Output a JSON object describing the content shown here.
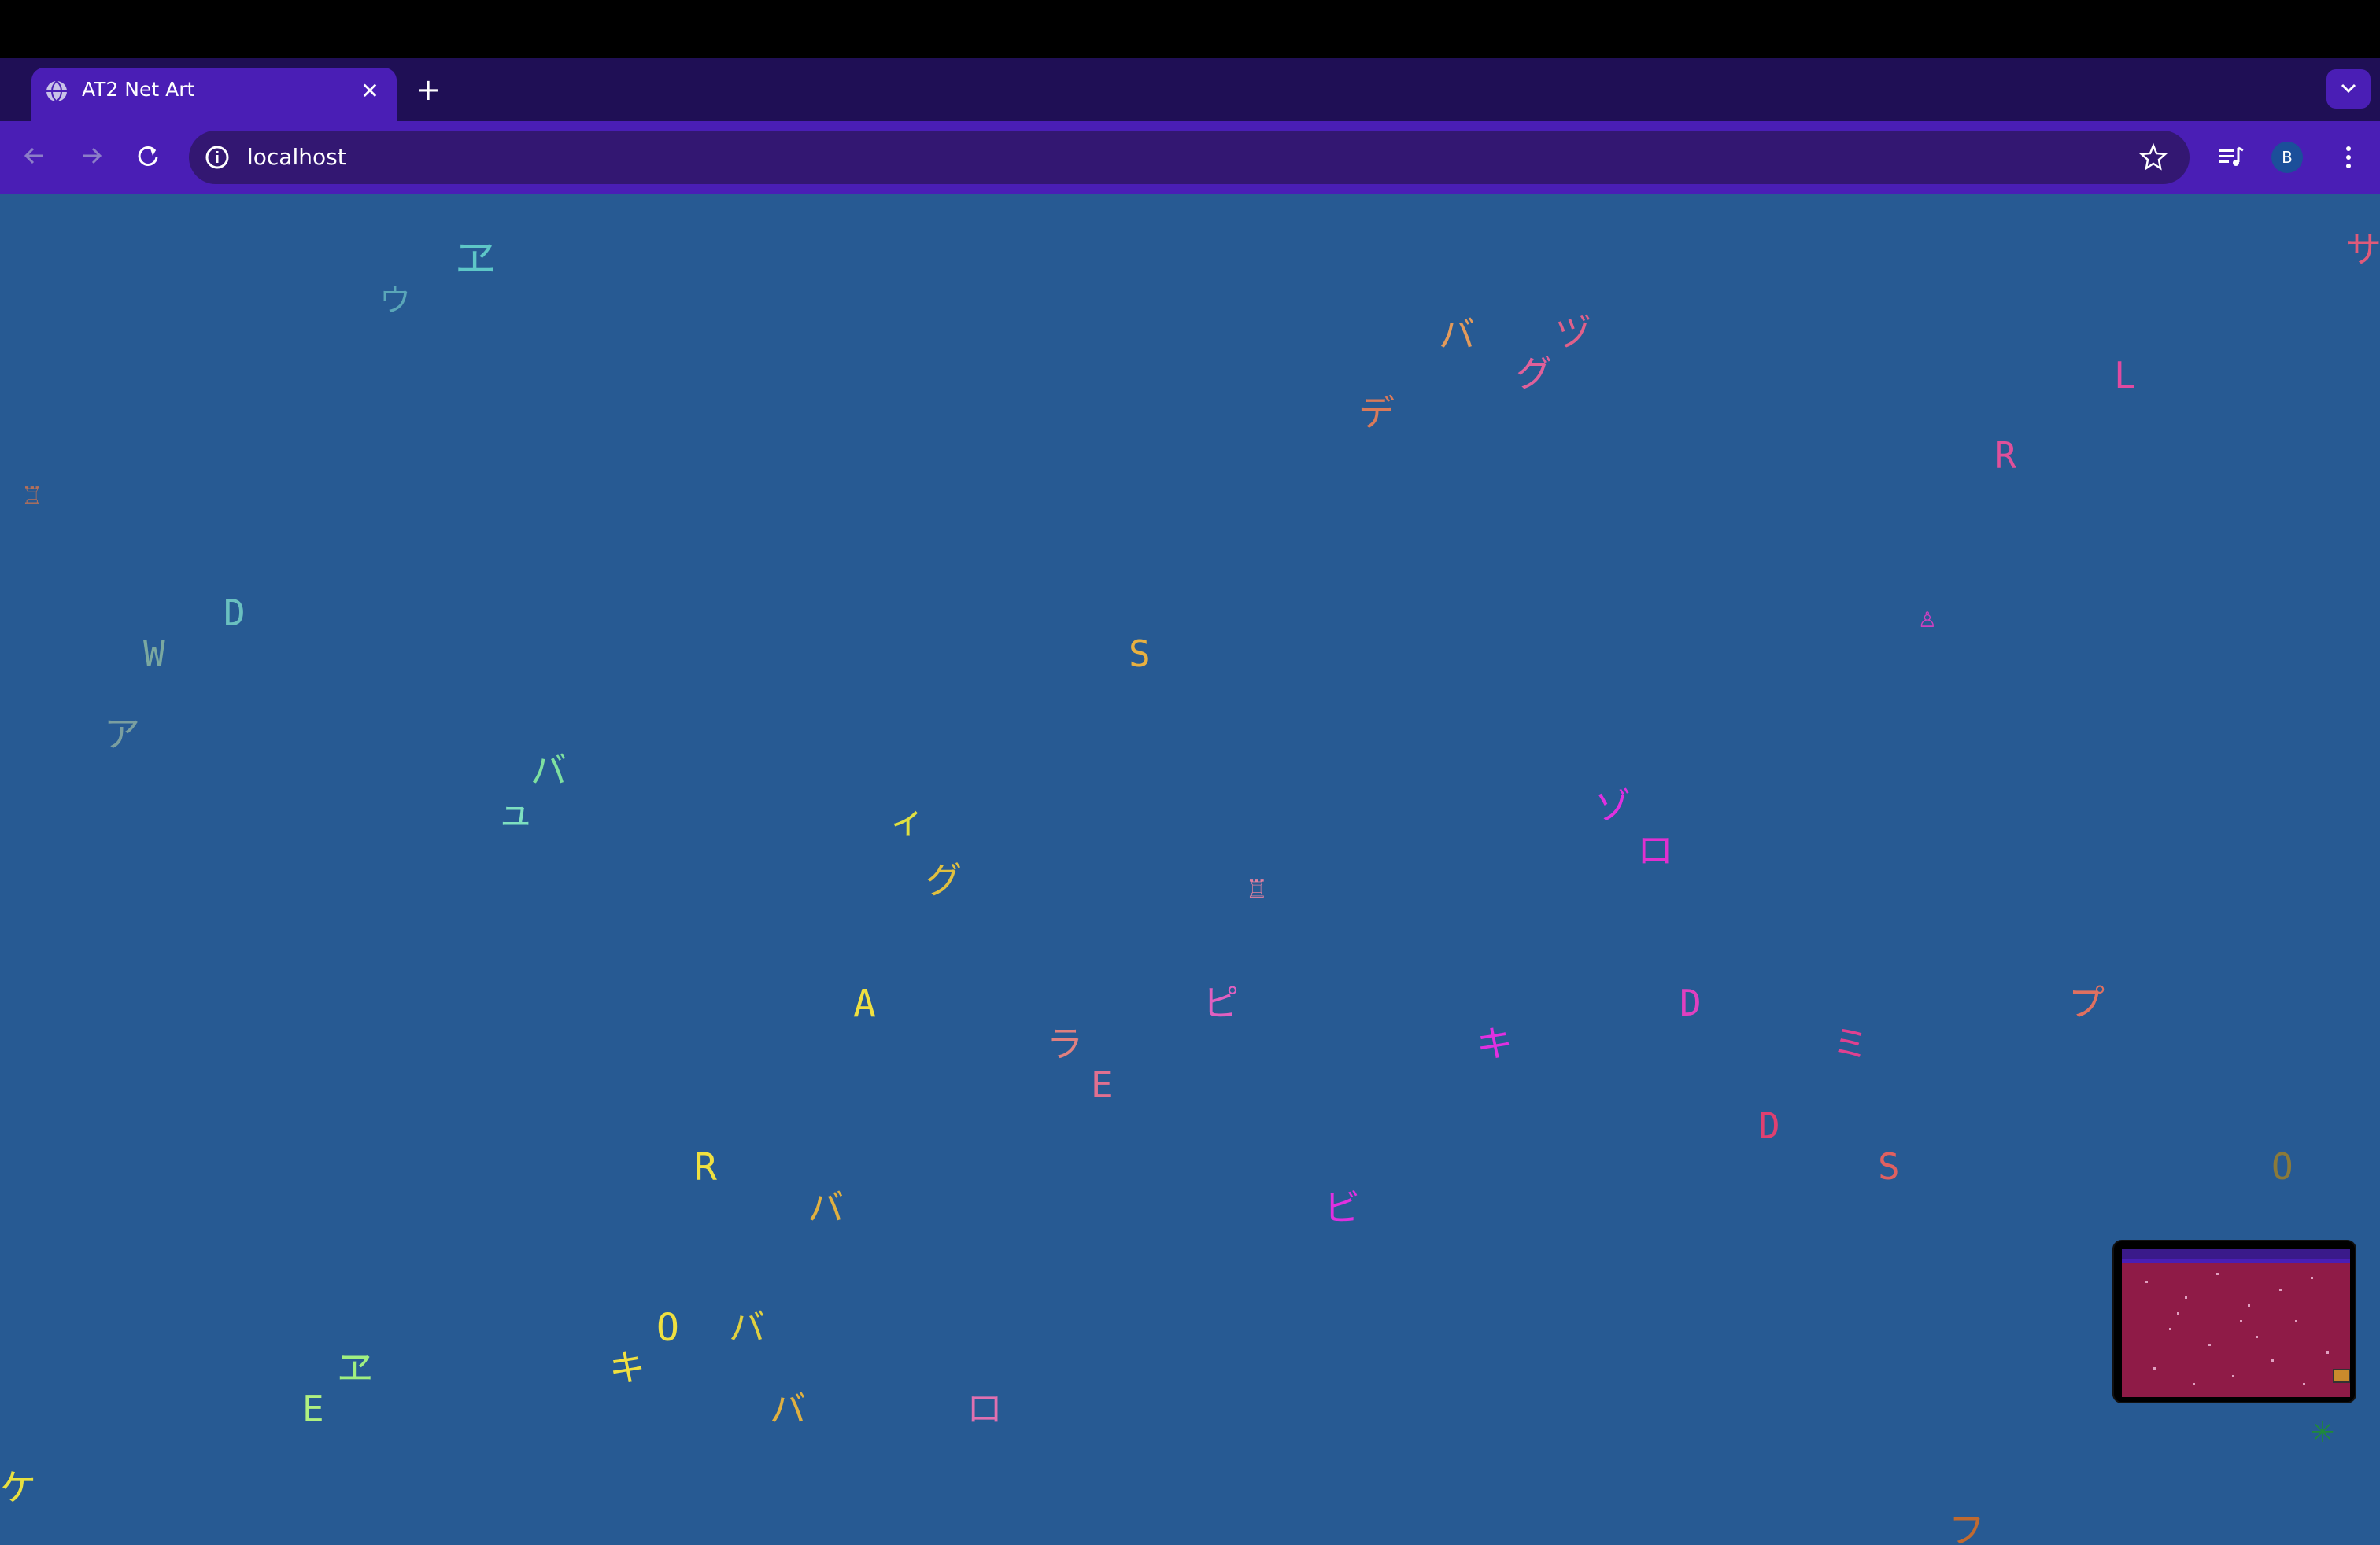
{
  "browser": {
    "tab": {
      "title": "AT2 Net Art",
      "favicon": "globe-icon"
    },
    "new_tab_label": "+",
    "close_label": "✕",
    "address_bar": {
      "url": "localhost"
    },
    "profile_initial": "B",
    "colors": {
      "tab_strip": "#1f0f55",
      "toolbar": "#4a1eb5",
      "omnibox": "#331772"
    }
  },
  "page": {
    "background": "#275a93",
    "glyphs": [
      {
        "char": "ヱ",
        "color": "#5ec7c7"
      },
      {
        "char": "ウ",
        "color": "#5aa6b8"
      },
      {
        "char": "バ",
        "color": "#e39a5a"
      },
      {
        "char": "ヅ",
        "color": "#e0608a"
      },
      {
        "char": "グ",
        "color": "#e0609a"
      },
      {
        "char": "デ",
        "color": "#d97a5a"
      },
      {
        "char": "L",
        "color": "#e04aa0"
      },
      {
        "char": "R",
        "color": "#e0509a"
      },
      {
        "char": "サ",
        "color": "#e05a7a"
      },
      {
        "char": "♖",
        "color": "#b5705a"
      },
      {
        "char": "D",
        "color": "#6ac0c0"
      },
      {
        "char": "W",
        "color": "#7aa8a0"
      },
      {
        "char": "S",
        "color": "#e8b040"
      },
      {
        "char": "♙",
        "color": "#d040c0"
      },
      {
        "char": "ア",
        "color": "#7a9fa0"
      },
      {
        "char": "バ",
        "color": "#7ee0a0"
      },
      {
        "char": "ュ",
        "color": "#7ee0c0"
      },
      {
        "char": "ィ",
        "color": "#e0e040"
      },
      {
        "char": "グ",
        "color": "#e0c040"
      },
      {
        "char": "♖",
        "color": "#e080a0"
      },
      {
        "char": "ゾ",
        "color": "#e030e0"
      },
      {
        "char": "ロ",
        "color": "#e030d0"
      },
      {
        "char": "A",
        "color": "#f0e040"
      },
      {
        "char": "ピ",
        "color": "#e060c0"
      },
      {
        "char": "ラ",
        "color": "#e08080"
      },
      {
        "char": "E",
        "color": "#e07090"
      },
      {
        "char": "キ",
        "color": "#e030e0"
      },
      {
        "char": "D",
        "color": "#e040c0"
      },
      {
        "char": "ミ",
        "color": "#e04090"
      },
      {
        "char": "プ",
        "color": "#e07060"
      },
      {
        "char": "D",
        "color": "#e04070"
      },
      {
        "char": "S",
        "color": "#e06060"
      },
      {
        "char": "O",
        "color": "#8a7a3a"
      },
      {
        "char": "R",
        "color": "#f0e040"
      },
      {
        "char": "バ",
        "color": "#e0b040"
      },
      {
        "char": "ビ",
        "color": "#e030e0"
      },
      {
        "char": "O",
        "color": "#f0e040"
      },
      {
        "char": "バ",
        "color": "#e0d040"
      },
      {
        "char": "ヱ",
        "color": "#a0f080"
      },
      {
        "char": "E",
        "color": "#b0f080"
      },
      {
        "char": "キ",
        "color": "#f0e040"
      },
      {
        "char": "バ",
        "color": "#e0b040"
      },
      {
        "char": "ロ",
        "color": "#e070b0"
      },
      {
        "char": "ケ",
        "color": "#e8e040"
      },
      {
        "char": "フ",
        "color": "#c06a30"
      }
    ],
    "minimap": {
      "background": "#8f1b47"
    },
    "asterisk": {
      "char": "✳",
      "color": "#1f8a3a"
    }
  }
}
